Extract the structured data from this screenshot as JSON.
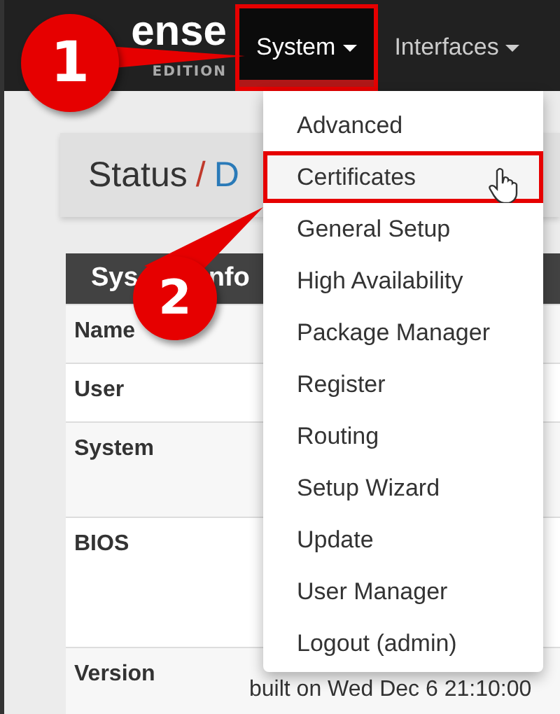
{
  "navbar": {
    "logo_text": "ense",
    "logo_subtitle": "EDITION",
    "menu": [
      {
        "label": "System",
        "open": true,
        "highlighted": true
      },
      {
        "label": "Interfaces",
        "open": false,
        "highlighted": false
      }
    ]
  },
  "dropdown": {
    "items": [
      {
        "label": "Advanced",
        "selected": false
      },
      {
        "label": "Certificates",
        "selected": true
      },
      {
        "label": "General Setup",
        "selected": false
      },
      {
        "label": "High Availability",
        "selected": false
      },
      {
        "label": "Package Manager",
        "selected": false
      },
      {
        "label": "Register",
        "selected": false
      },
      {
        "label": "Routing",
        "selected": false
      },
      {
        "label": "Setup Wizard",
        "selected": false
      },
      {
        "label": "Update",
        "selected": false
      },
      {
        "label": "User Manager",
        "selected": false
      },
      {
        "label": "Logout (admin)",
        "selected": false
      }
    ]
  },
  "breadcrumb": {
    "section": "Status",
    "separator": "/",
    "page": "D"
  },
  "panel": {
    "heading_parts": [
      "Sys",
      "nfo"
    ],
    "rows": [
      {
        "label": "Name"
      },
      {
        "label": "User"
      },
      {
        "label": "System"
      },
      {
        "label": "BIOS"
      },
      {
        "label": "Version",
        "value": "built on Wed Dec 6 21:10:00"
      }
    ]
  },
  "callouts": [
    {
      "number": "1"
    },
    {
      "number": "2"
    }
  ]
}
